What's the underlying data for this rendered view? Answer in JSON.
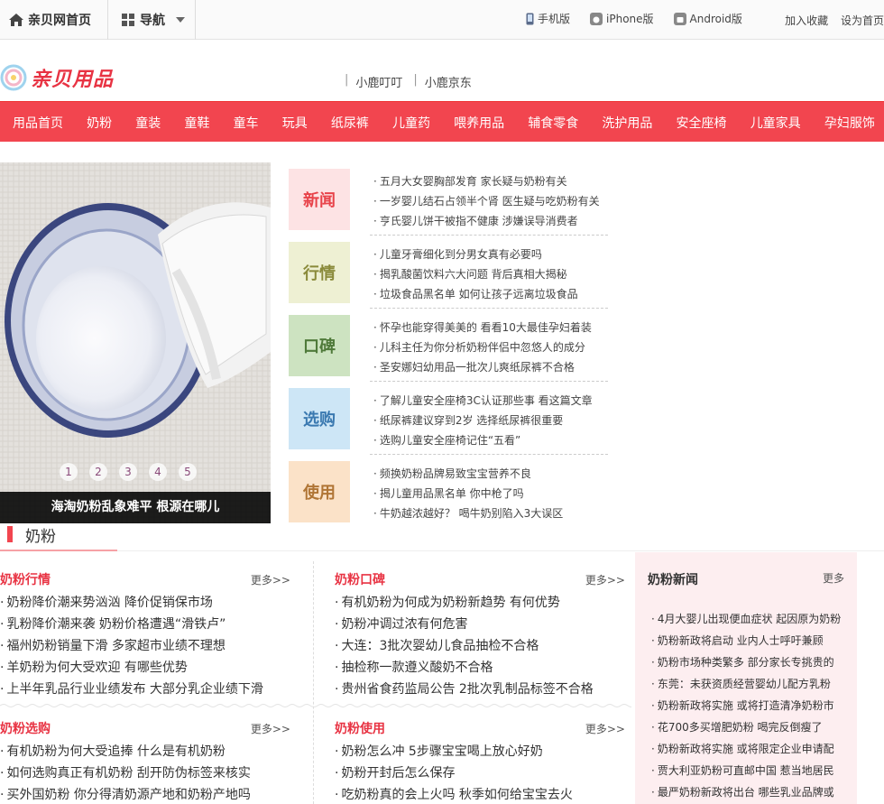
{
  "topbar": {
    "home": "亲贝网首页",
    "nav": "导航",
    "apps": [
      "手机版",
      "iPhone版",
      "Android版"
    ],
    "links": [
      "加入收藏",
      "设为首页"
    ]
  },
  "logo": {
    "name": "亲贝用品"
  },
  "sublinks": [
    "小鹿叮叮",
    "小鹿京东"
  ],
  "rednav": [
    "用品首页",
    "奶粉",
    "童装",
    "童鞋",
    "童车",
    "玩具",
    "纸尿裤",
    "儿童药",
    "喂养用品",
    "辅食零食",
    "洗护用品",
    "安全座椅",
    "儿童家具",
    "孕妇服饰"
  ],
  "slide": {
    "caption": "海淘奶粉乱象难平 根源在哪儿",
    "dots": [
      "1",
      "2",
      "3",
      "4",
      "5"
    ]
  },
  "blocks": [
    {
      "tag": "新闻",
      "color": "#fde3e4",
      "text": "#e8434a",
      "items": [
        "五月大女婴胸部发育 家长疑与奶粉有关",
        "一岁婴儿结石占领半个肾 医生疑与吃奶粉有关",
        "亨氏婴儿饼干被指不健康 涉嫌误导消费者"
      ]
    },
    {
      "tag": "行情",
      "color": "#eef0d3",
      "text": "#8a8a3a",
      "items": [
        "儿童牙膏细化到分男女真有必要吗",
        "揭乳酸菌饮料六大问题 背后真相大揭秘",
        "垃圾食品黑名单 如何让孩子远离垃圾食品"
      ]
    },
    {
      "tag": "口碑",
      "color": "#cde3c1",
      "text": "#4f7a3a",
      "items": [
        "怀孕也能穿得美美的 看看10大最佳孕妇着装",
        "儿科主任为你分析奶粉伴侣中忽悠人的成分",
        "圣安娜妇幼用品一批次儿爽纸尿裤不合格"
      ]
    },
    {
      "tag": "选购",
      "color": "#cde6f6",
      "text": "#3a79b0",
      "items": [
        "了解儿童安全座椅3C认证那些事 看这篇文章",
        "纸尿裤建议穿到2岁 选择纸尿裤很重要",
        "选购儿童安全座椅记住“五看”"
      ]
    },
    {
      "tag": "使用",
      "color": "#fbe2c8",
      "text": "#b07535",
      "items": [
        "频换奶粉品牌易致宝宝营养不良",
        "揭儿童用品黑名单 你中枪了吗",
        "牛奶越浓越好？ 喝牛奶别陷入3大误区"
      ]
    }
  ],
  "section": {
    "title": "奶粉"
  },
  "lists": [
    {
      "title": "奶粉行情",
      "more": "更多>>",
      "items": [
        "奶粉降价潮来势汹汹 降价促销保市场",
        "乳粉降价潮来袭 奶粉价格遭遇“滑铁卢”",
        "福州奶粉销量下滑 多家超市业绩不理想",
        "羊奶粉为何大受欢迎 有哪些优势",
        "上半年乳品行业业绩发布 大部分乳企业绩下滑"
      ]
    },
    {
      "title": "奶粉口碑",
      "more": "更多>>",
      "items": [
        "有机奶粉为何成为奶粉新趋势 有何优势",
        "奶粉冲调过浓有何危害",
        "大连：3批次婴幼儿食品抽检不合格",
        "抽检称一款遵义酸奶不合格",
        "贵州省食药监局公告 2批次乳制品标签不合格"
      ]
    },
    {
      "title": "奶粉选购",
      "more": "更多>>",
      "items": [
        "有机奶粉为何大受追捧 什么是有机奶粉",
        "如何选购真正有机奶粉 刮开防伪标签来核实",
        "买外国奶粉 你分得清奶源产地和奶粉产地吗"
      ]
    },
    {
      "title": "奶粉使用",
      "more": "更多>>",
      "items": [
        "奶粉怎么冲 5步骤宝宝喝上放心好奶",
        "奶粉开封后怎么保存",
        "吃奶粉真的会上火吗 秋季如何给宝宝去火"
      ]
    }
  ],
  "newsbox": {
    "title": "奶粉新闻",
    "more": "更多",
    "items": [
      "4月大婴儿出现便血症状 起因原为奶粉",
      "奶粉新政将启动 业内人士呼吁兼顾",
      "奶粉市场种类繁多 部分家长专挑贵的",
      "东莞：未获资质经营婴幼儿配方乳粉",
      "奶粉新政将实施 或将打造清净奶粉市",
      "花700多买增肥奶粉 喝完反倒瘦了",
      "奶粉新政将实施 或将限定企业申请配",
      "贾大利亚奶粉可直邮中国 惹当地居民",
      "最严奶粉新政将出台 哪些乳业品牌或"
    ]
  }
}
